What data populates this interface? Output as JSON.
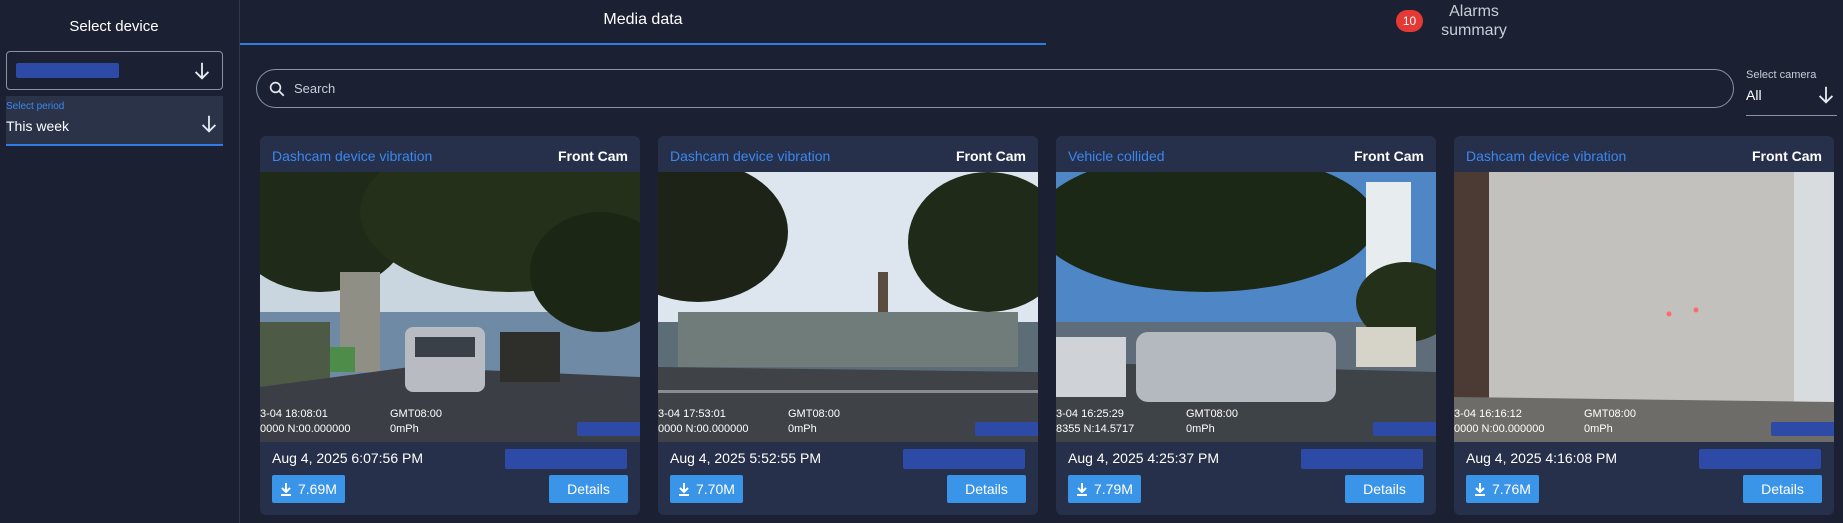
{
  "sidebar": {
    "title": "Select device",
    "period_label": "Select period",
    "period_value": "This week"
  },
  "tabs": {
    "media_label": "Media data",
    "alarms_count": "10",
    "alarms_label": "Alarms summary"
  },
  "search": {
    "placeholder": "Search"
  },
  "camera": {
    "label": "Select camera",
    "value": "All"
  },
  "colors": {
    "background": "#1b2132",
    "card": "#26304a",
    "accent": "#2f7be8",
    "button": "#3a94e8",
    "badge": "#e53935",
    "redaction": "#2c4aa6"
  },
  "cards": [
    {
      "event": "Dashcam device vibration",
      "camera": "Front Cam",
      "date": "Aug 4, 2025 6:07:56 PM",
      "size": "7.69M",
      "details": "Details",
      "osd_time": "3-04  18:08:01",
      "osd_coord": "0000  N:00.000000",
      "osd_tz": "GMT08:00",
      "osd_speed": "0mPh"
    },
    {
      "event": "Dashcam device vibration",
      "camera": "Front Cam",
      "date": "Aug 4, 2025 5:52:55 PM",
      "size": "7.70M",
      "details": "Details",
      "osd_time": "3-04  17:53:01",
      "osd_coord": "0000  N:00.000000",
      "osd_tz": "GMT08:00",
      "osd_speed": "0mPh"
    },
    {
      "event": "Vehicle collided",
      "camera": "Front Cam",
      "date": "Aug 4, 2025 4:25:37 PM",
      "size": "7.79M",
      "details": "Details",
      "osd_time": "3-04  16:25:29",
      "osd_coord": "8355  N:14.5717",
      "osd_tz": "GMT08:00",
      "osd_speed": "0mPh"
    },
    {
      "event": "Dashcam device vibration",
      "camera": "Front Cam",
      "date": "Aug 4, 2025 4:16:08 PM",
      "size": "7.76M",
      "details": "Details",
      "osd_time": "3-04  16:16:12",
      "osd_coord": "0000  N:00.000000",
      "osd_tz": "GMT08:00",
      "osd_speed": "0mPh"
    }
  ]
}
